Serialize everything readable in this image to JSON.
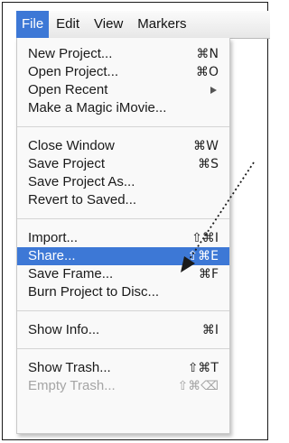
{
  "menubar": {
    "items": [
      "File",
      "Edit",
      "View",
      "Markers"
    ],
    "active_index": 0
  },
  "file_menu": {
    "groups": [
      [
        {
          "label": "New Project...",
          "shortcut": "⌘N"
        },
        {
          "label": "Open Project...",
          "shortcut": "⌘O"
        },
        {
          "label": "Open Recent",
          "submenu": true
        },
        {
          "label": "Make a Magic iMovie..."
        }
      ],
      [
        {
          "label": "Close Window",
          "shortcut": "⌘W"
        },
        {
          "label": "Save Project",
          "shortcut": "⌘S"
        },
        {
          "label": "Save Project As..."
        },
        {
          "label": "Revert to Saved..."
        }
      ],
      [
        {
          "label": "Import...",
          "shortcut": "⇧⌘I"
        },
        {
          "label": "Share...",
          "shortcut": "⇧⌘E",
          "highlighted": true
        },
        {
          "label": "Save Frame...",
          "shortcut": "⌘F"
        },
        {
          "label": "Burn Project to Disc..."
        }
      ],
      [
        {
          "label": "Show Info...",
          "shortcut": "⌘I"
        }
      ],
      [
        {
          "label": "Show Trash...",
          "shortcut": "⇧⌘T"
        },
        {
          "label": "Empty Trash...",
          "shortcut": "⇧⌘⌫",
          "disabled": true
        }
      ]
    ]
  },
  "colors": {
    "highlight": "#3d78d6",
    "disabled_text": "#a5a5a5",
    "annotation": "#1a1a1a"
  }
}
